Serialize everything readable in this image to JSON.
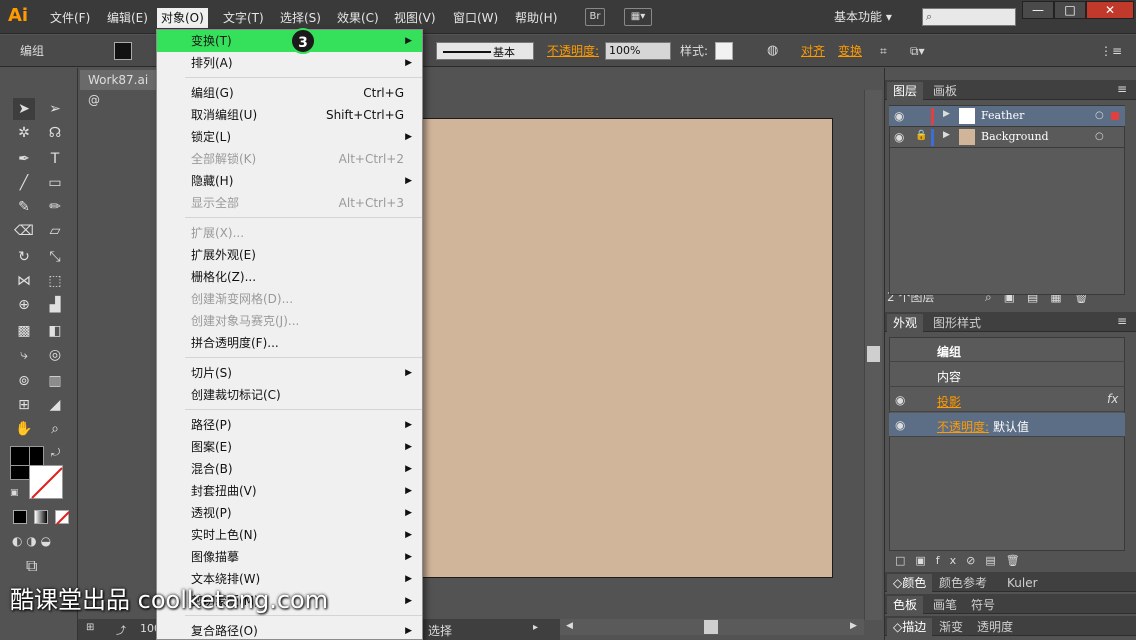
{
  "app": {
    "logo": "Ai"
  },
  "menubar": {
    "items": [
      "文件(F)",
      "编辑(E)",
      "对象(O)",
      "文字(T)",
      "选择(S)",
      "效果(C)",
      "视图(V)",
      "窗口(W)",
      "帮助(H)"
    ],
    "br_label": "Br",
    "workspace": "基本功能",
    "search_placeholder": ""
  },
  "control": {
    "selection": "编组",
    "stroke_label": "基本",
    "opacity_label": "不透明度:",
    "opacity_value": "100%",
    "style_label": "样式:",
    "align_label": "对齐",
    "transform_label": "变换"
  },
  "document": {
    "tab": "Work87.ai @"
  },
  "menu": {
    "rows": [
      {
        "label": "变换(T)",
        "shortcut": "",
        "arrow": true,
        "disabled": false,
        "highlight": true
      },
      {
        "label": "排列(A)",
        "shortcut": "",
        "arrow": true,
        "disabled": false
      },
      {
        "label": "编组(G)",
        "shortcut": "Ctrl+G",
        "arrow": false,
        "disabled": false
      },
      {
        "label": "取消编组(U)",
        "shortcut": "Shift+Ctrl+G",
        "arrow": false,
        "disabled": false
      },
      {
        "label": "锁定(L)",
        "shortcut": "",
        "arrow": true,
        "disabled": false
      },
      {
        "label": "全部解锁(K)",
        "shortcut": "Alt+Ctrl+2",
        "arrow": false,
        "disabled": true
      },
      {
        "label": "隐藏(H)",
        "shortcut": "",
        "arrow": true,
        "disabled": false
      },
      {
        "label": "显示全部",
        "shortcut": "Alt+Ctrl+3",
        "arrow": false,
        "disabled": true
      },
      {
        "label": "扩展(X)...",
        "shortcut": "",
        "arrow": false,
        "disabled": true
      },
      {
        "label": "扩展外观(E)",
        "shortcut": "",
        "arrow": false,
        "disabled": false
      },
      {
        "label": "栅格化(Z)...",
        "shortcut": "",
        "arrow": false,
        "disabled": false
      },
      {
        "label": "创建渐变网格(D)...",
        "shortcut": "",
        "arrow": false,
        "disabled": true
      },
      {
        "label": "创建对象马赛克(J)...",
        "shortcut": "",
        "arrow": false,
        "disabled": true
      },
      {
        "label": "拼合透明度(F)...",
        "shortcut": "",
        "arrow": false,
        "disabled": false
      },
      {
        "label": "切片(S)",
        "shortcut": "",
        "arrow": true,
        "disabled": false
      },
      {
        "label": "创建裁切标记(C)",
        "shortcut": "",
        "arrow": false,
        "disabled": false
      },
      {
        "label": "路径(P)",
        "shortcut": "",
        "arrow": true,
        "disabled": false
      },
      {
        "label": "图案(E)",
        "shortcut": "",
        "arrow": true,
        "disabled": false
      },
      {
        "label": "混合(B)",
        "shortcut": "",
        "arrow": true,
        "disabled": false
      },
      {
        "label": "封套扭曲(V)",
        "shortcut": "",
        "arrow": true,
        "disabled": false
      },
      {
        "label": "透视(P)",
        "shortcut": "",
        "arrow": true,
        "disabled": false
      },
      {
        "label": "实时上色(N)",
        "shortcut": "",
        "arrow": true,
        "disabled": false
      },
      {
        "label": "图像描摹",
        "shortcut": "",
        "arrow": true,
        "disabled": false
      },
      {
        "label": "文本绕排(W)",
        "shortcut": "",
        "arrow": true,
        "disabled": false
      },
      {
        "label": "剪切蒙版(M)",
        "shortcut": "",
        "arrow": true,
        "disabled": false
      },
      {
        "label": "复合路径(O)",
        "shortcut": "",
        "arrow": true,
        "disabled": false
      }
    ],
    "step_badge": "3"
  },
  "layers": {
    "tabs": [
      "图层",
      "画板"
    ],
    "rows": [
      {
        "name": "Feather",
        "selected": true
      },
      {
        "name": "Background",
        "selected": false
      }
    ],
    "count": "2 个图层"
  },
  "appearance": {
    "tabs": [
      "外观",
      "图形样式"
    ],
    "title": "编组",
    "content": "内容",
    "shadow": "投影",
    "fx": "fx",
    "opacity_label": "不透明度:",
    "opacity_value": "默认值"
  },
  "bottom_panels": {
    "row1": [
      "颜色",
      "颜色参考",
      "Kuler"
    ],
    "row2": [
      "色板",
      "画笔",
      "符号"
    ],
    "row3": [
      "描边",
      "渐变",
      "透明度"
    ]
  },
  "statusbar": {
    "zoom": "100",
    "tool": "选择"
  },
  "watermark": "酷课堂出品 coolketang.com",
  "colors": {
    "accent": "#ff9a00",
    "highlight": "#35e05a",
    "artboard": "#d1b59a",
    "layer_sel": "#5c6e86"
  }
}
